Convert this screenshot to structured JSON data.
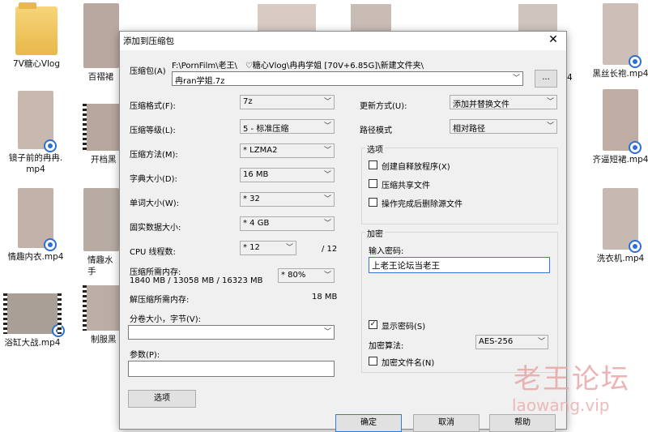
{
  "desktop": {
    "icons": [
      {
        "label": "7V糖心Vlog",
        "kind": "folder"
      },
      {
        "label": "百褶裙",
        "kind": "video"
      },
      {
        "label": "镜子前的冉冉.",
        "label2": "mp4",
        "kind": "video"
      },
      {
        "label": "开档黑",
        "kind": "video"
      },
      {
        "label": "情趣内衣.mp4",
        "kind": "video"
      },
      {
        "label": "情趣水手",
        "kind": "video"
      },
      {
        "label": "浴缸大战.mp4",
        "kind": "video"
      },
      {
        "label": "制服黑",
        "kind": "video"
      },
      {
        "label": "4",
        "kind": "partial"
      },
      {
        "label": "黑丝长袍.mp4",
        "kind": "video"
      },
      {
        "label": "齐逼短裙.mp4",
        "kind": "video"
      },
      {
        "label": "洗衣机.mp4",
        "kind": "video"
      }
    ]
  },
  "dialog": {
    "title": "添加到压缩包",
    "close_glyph": "✕",
    "archive_label": "压缩包(A)",
    "archive_path": "F:\\PornFilm\\老王\\　♡糖心Vlog\\冉冉学姐 [70V+6.85G]\\新建文件夹\\",
    "archive_name": "冉ran学姐.7z",
    "browse_label": "...",
    "left": {
      "format_label": "压缩格式(F):",
      "format_value": "7z",
      "level_label": "压缩等级(L):",
      "level_value": "5 - 标准压缩",
      "method_label": "压缩方法(M):",
      "method_value": "*  LZMA2",
      "dict_label": "字典大小(D):",
      "dict_value": "16 MB",
      "word_label": "单词大小(W):",
      "word_value": "*  32",
      "solid_label": "固实数据大小:",
      "solid_value": "*  4 GB",
      "cpu_label": "CPU 线程数:",
      "cpu_value": "*  12",
      "cpu_total": "/ 12",
      "mem_label": "压缩所需内存:",
      "mem_value": "1840 MB / 13058 MB / 16323 MB",
      "mem_pct": "* 80%",
      "decomp_label": "解压缩所需内存:",
      "decomp_value": "18 MB",
      "split_label": "分卷大小，字节(V):",
      "split_value": "",
      "params_label": "参数(P):",
      "params_value": "",
      "options_button": "选项"
    },
    "right": {
      "update_label": "更新方式(U):",
      "update_value": "添加并替换文件",
      "pathmode_label": "路径模式",
      "pathmode_value": "相对路径",
      "options_group": "选项",
      "opt_sfx": "创建自释放程序(X)",
      "opt_shared": "压缩共享文件",
      "opt_delete": "操作完成后删除源文件",
      "encrypt_group": "加密",
      "password_label": "输入密码:",
      "password_value": "上老王论坛当老王",
      "show_password": "显示密码(S)",
      "show_password_checked": "✓",
      "enc_method_label": "加密算法:",
      "enc_method_value": "AES-256",
      "enc_names": "加密文件名(N)"
    },
    "buttons": {
      "ok": "确定",
      "cancel": "取消",
      "help": "帮助"
    }
  },
  "watermark": {
    "title": "老王论坛",
    "url": "laowang.vip"
  },
  "colors": {
    "accent": "#2f7bd8",
    "dialog_bg": "#f0f0f0",
    "watermark": "#e9a7a7"
  }
}
